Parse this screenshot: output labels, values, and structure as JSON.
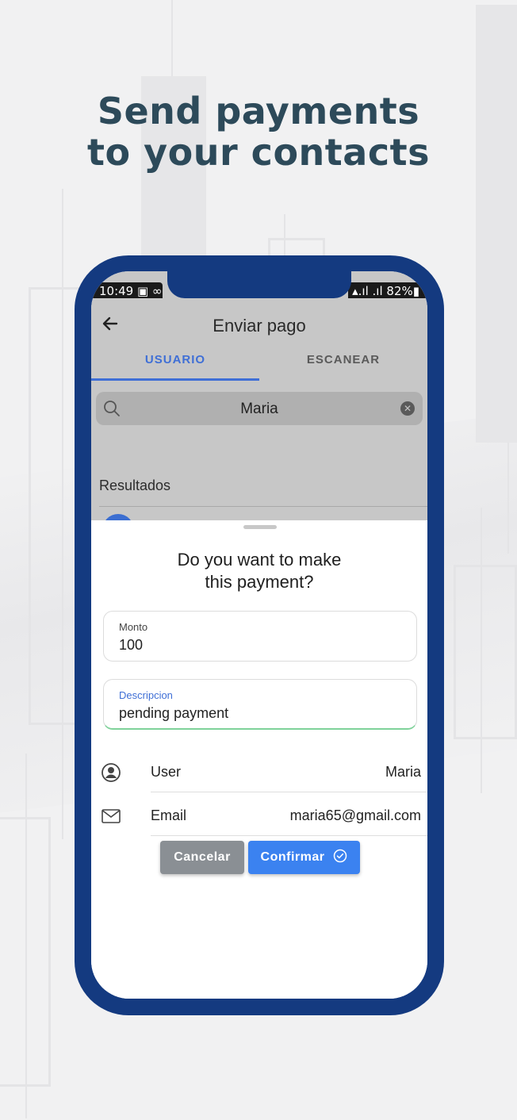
{
  "headline": {
    "line1": "Send payments",
    "line2": "to your contacts"
  },
  "status_bar": {
    "time": "10:49 ▣ ∞",
    "right": "▴.ıl .ıl 82%▮"
  },
  "app_bar": {
    "title": "Enviar pago",
    "back_icon": "arrow-left-icon"
  },
  "tabs": [
    {
      "label": "USUARIO",
      "active": true
    },
    {
      "label": "ESCANEAR",
      "active": false
    }
  ],
  "search": {
    "value": "Maria",
    "icon": "search-icon",
    "clear_icon": "clear-icon"
  },
  "results": {
    "label": "Resultados"
  },
  "sheet": {
    "title": "Do you want to make\nthis payment?",
    "amount": {
      "label": "Monto",
      "value": "100"
    },
    "description": {
      "label": "Descripcion",
      "value": "pending payment"
    },
    "user_row": {
      "label": "User",
      "value": "Maria",
      "icon": "user-circle-icon"
    },
    "email_row": {
      "label": "Email",
      "value": "maria65@gmail.com",
      "icon": "mail-icon"
    },
    "buttons": {
      "cancel": "Cancelar",
      "confirm": "Confirmar"
    }
  },
  "colors": {
    "phone_frame": "#143a80",
    "accent": "#3f6fd6",
    "confirm_button": "#3b82f0",
    "cancel_button": "#8a8f94",
    "headline": "#2d4a5a"
  }
}
